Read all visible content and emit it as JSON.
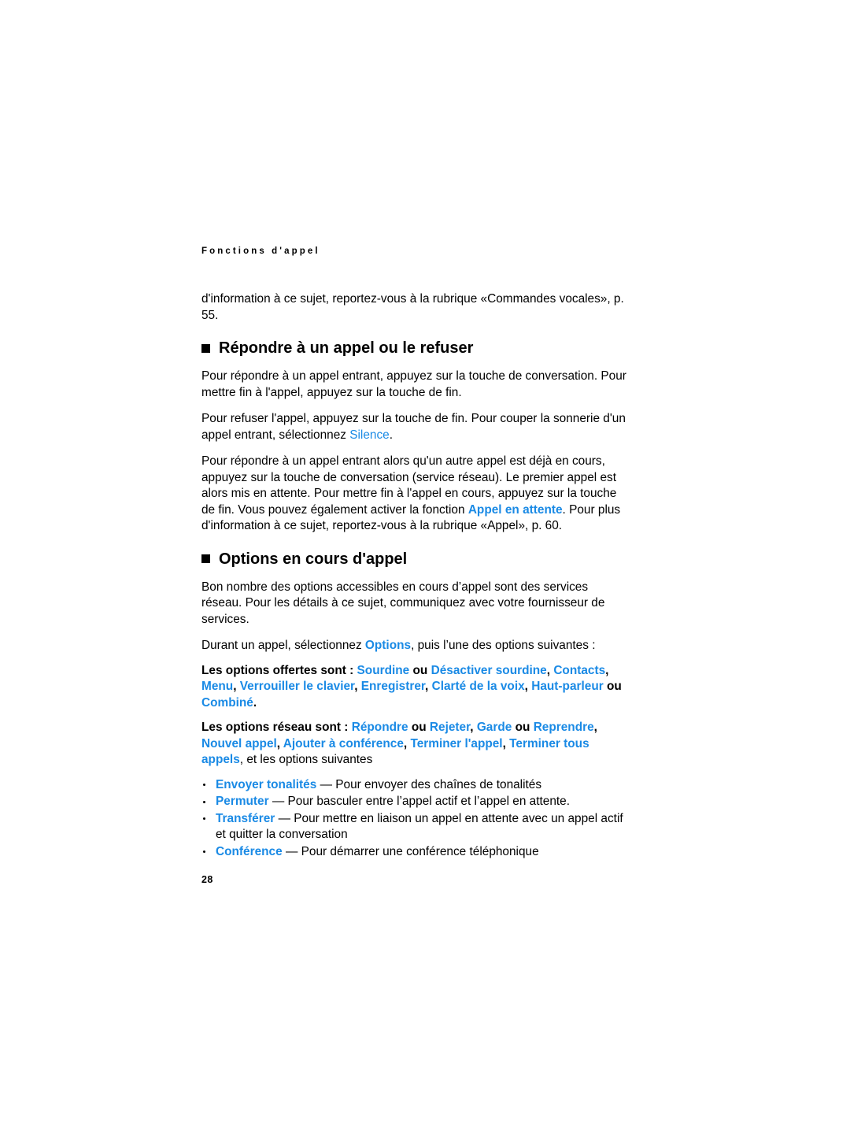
{
  "page": {
    "running_header": "Fonctions d'appel",
    "folio": "28",
    "accent_color": "#1a8ae5",
    "text_color": "#000000",
    "background_color": "#ffffff"
  },
  "intro": {
    "text": "d'information à ce sujet, reportez-vous à la rubrique «Commandes vocales», p. 55."
  },
  "sections": [
    {
      "heading": "Répondre à un appel ou le refuser",
      "paragraphs": {
        "p1": "Pour répondre à un appel entrant, appuyez sur la touche de conversation. Pour mettre fin à l'appel, appuyez sur la touche de fin.",
        "p2_a": "Pour refuser l'appel, appuyez sur la touche de fin. Pour couper la sonnerie d'un appel entrant, sélectionnez ",
        "p2_kw": "Silence",
        "p2_b": ".",
        "p3_a": "Pour répondre à un appel entrant alors qu'un autre appel est déjà en cours, appuyez sur la touche de conversation (service réseau). Le premier appel est alors mis en attente. Pour mettre fin à l'appel en cours, appuyez sur la touche de fin. Vous pouvez également activer la fonction ",
        "p3_kw": "Appel en attente",
        "p3_b": ". Pour plus d'information à ce sujet, reportez-vous à la rubrique «Appel», p. 60."
      }
    },
    {
      "heading": "Options en cours d'appel",
      "paragraphs": {
        "p1": "Bon nombre des options accessibles en cours d’appel sont des services réseau. Pour les détails à ce sujet, communiquez avec votre fournisseur de services.",
        "p2_a": "Durant un appel, sélectionnez ",
        "p2_kw": "Options",
        "p2_b": ", puis l’une des options suivantes :",
        "offered_lead": "Les options offertes sont : ",
        "offered_terms": [
          "Sourdine",
          "Désactiver sourdine",
          "Contacts",
          "Menu",
          "Verrouiller le clavier",
          "Enregistrer",
          "Clarté de la voix",
          "Haut-parleur",
          "Combiné"
        ],
        "network_lead": "Les options réseau sont : ",
        "network_terms": [
          "Répondre",
          "Rejeter",
          "Garde",
          "Reprendre",
          "Nouvel appel",
          "Ajouter à conférence",
          "Terminer l'appel",
          "Terminer tous appels"
        ],
        "network_tail": ", et les options suivantes",
        "conj_ou": "ou",
        "conj_et": "et"
      },
      "bullets": [
        {
          "term": "Envoyer tonalités",
          "dash": "—",
          "description": "Pour envoyer des chaînes de tonalités"
        },
        {
          "term": "Permuter",
          "dash": "—",
          "description": "Pour basculer entre l’appel actif et l’appel en attente."
        },
        {
          "term": "Transférer",
          "dash": "—",
          "description": "Pour mettre en liaison un appel en attente avec un appel actif et quitter la conversation"
        },
        {
          "term": "Conférence",
          "dash": "—",
          "description": "Pour démarrer une conférence téléphonique"
        }
      ]
    }
  ]
}
